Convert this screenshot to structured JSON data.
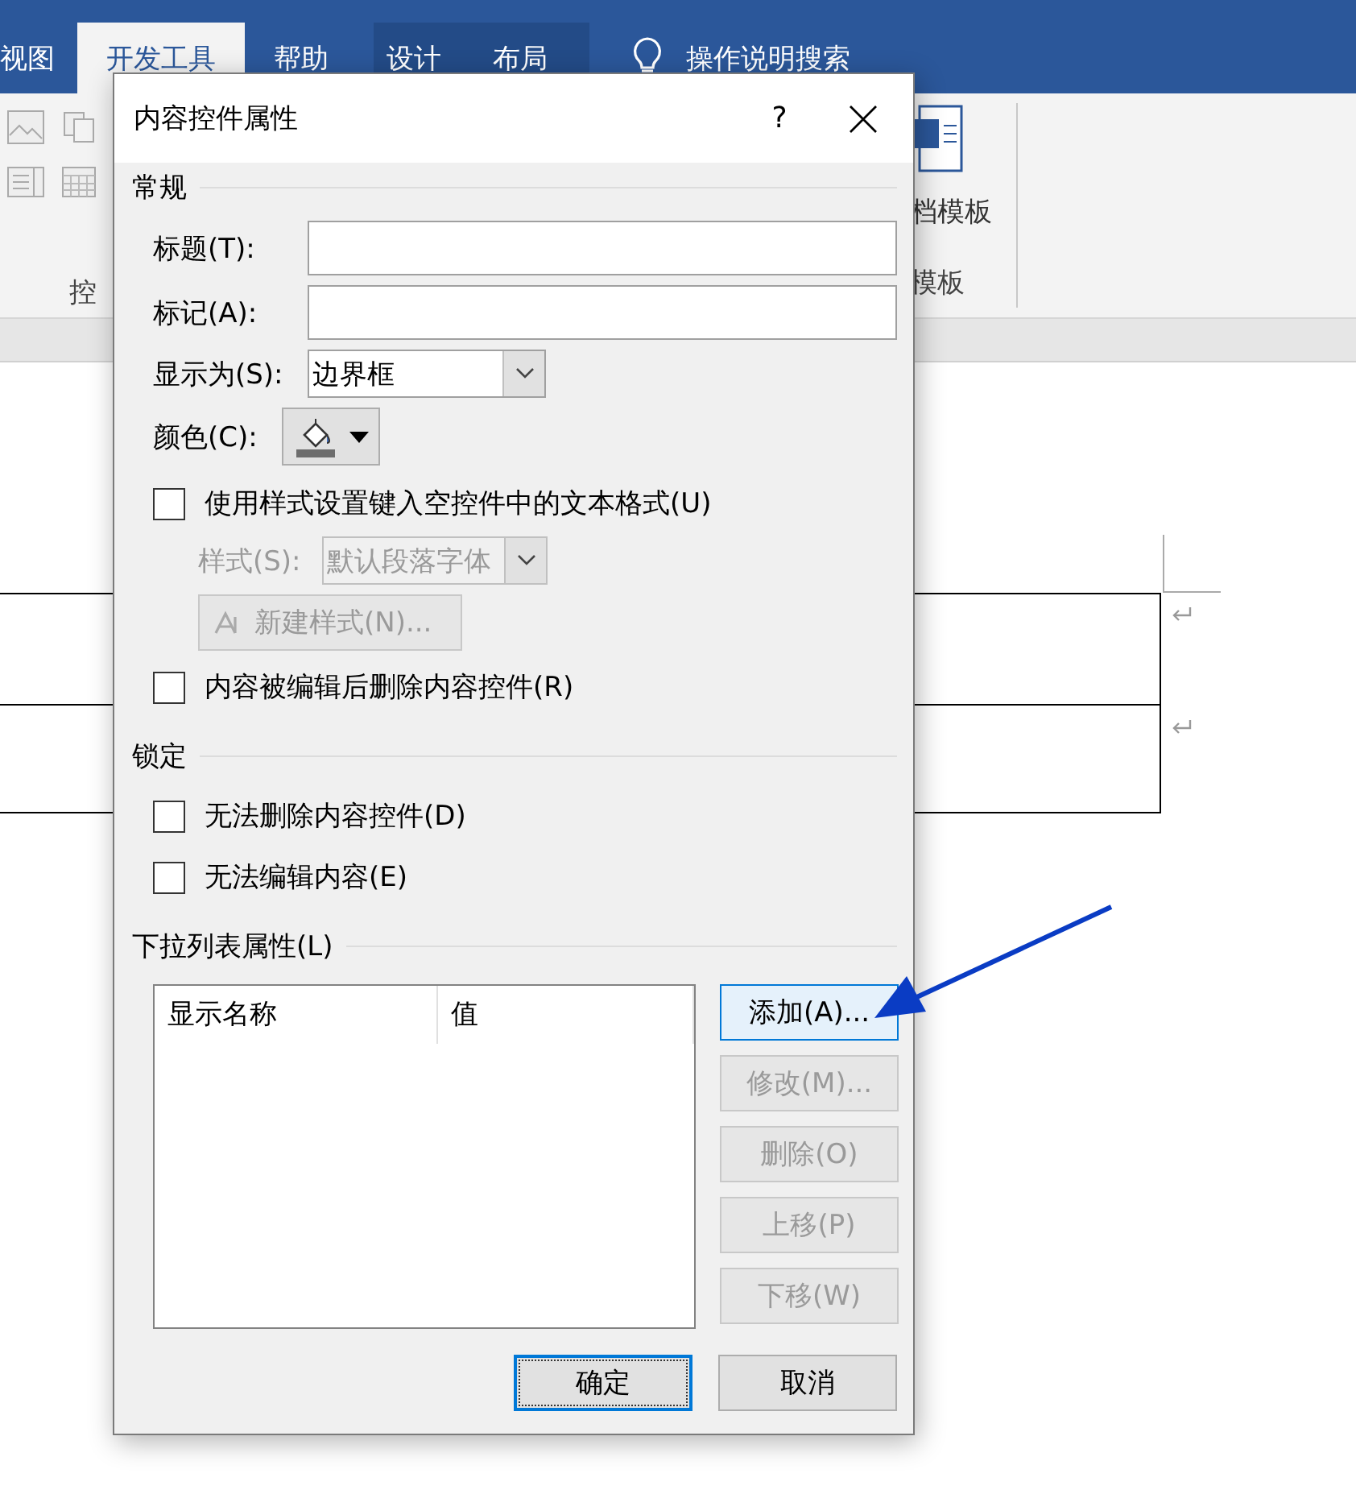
{
  "ribbon": {
    "tabs": [
      {
        "label": "视图",
        "selected": false,
        "kind": "normal"
      },
      {
        "label": "开发工具",
        "selected": true,
        "kind": "normal"
      },
      {
        "label": "帮助",
        "selected": false,
        "kind": "normal"
      },
      {
        "label": "设计",
        "selected": false,
        "kind": "context"
      },
      {
        "label": "布局",
        "selected": false,
        "kind": "context"
      }
    ],
    "search": {
      "label": "操作说明搜索"
    },
    "groups": [
      {
        "label": "控"
      },
      {
        "label": "模板"
      }
    ],
    "template_button": {
      "label": "档模板"
    }
  },
  "dialog": {
    "title": "内容控件属性",
    "help": "?",
    "general": {
      "heading": "常规",
      "fields": [
        {
          "label": "标题(T):"
        },
        {
          "label": "标记(A):"
        }
      ],
      "display_as": {
        "label": "显示为(S):",
        "value": "边界框"
      },
      "color": {
        "label": "颜色(C):"
      },
      "use_style": {
        "label": "使用样式设置键入空控件中的文本格式(U)",
        "checked": false
      },
      "style": {
        "label": "样式(S):",
        "value": "默认段落字体",
        "disabled": true
      },
      "new_style": {
        "label": "新建样式(N)...",
        "disabled": true
      },
      "remove_after_edit": {
        "label": "内容被编辑后删除内容控件(R)",
        "checked": false
      }
    },
    "locking": {
      "heading": "锁定",
      "options": [
        {
          "label": "无法删除内容控件(D)",
          "checked": false
        },
        {
          "label": "无法编辑内容(E)",
          "checked": false
        }
      ]
    },
    "dropdown": {
      "heading": "下拉列表属性(L)",
      "columns": [
        "显示名称",
        "值"
      ],
      "buttons": [
        {
          "label": "添加(A)...",
          "disabled": false,
          "hovered": true
        },
        {
          "label": "修改(M)...",
          "disabled": true,
          "hovered": false
        },
        {
          "label": "删除(O)",
          "disabled": true,
          "hovered": false
        },
        {
          "label": "上移(P)",
          "disabled": true,
          "hovered": false
        },
        {
          "label": "下移(W)",
          "disabled": true,
          "hovered": false
        }
      ]
    },
    "footer": [
      {
        "label": "确定",
        "default": true
      },
      {
        "label": "取消",
        "default": false
      }
    ]
  }
}
